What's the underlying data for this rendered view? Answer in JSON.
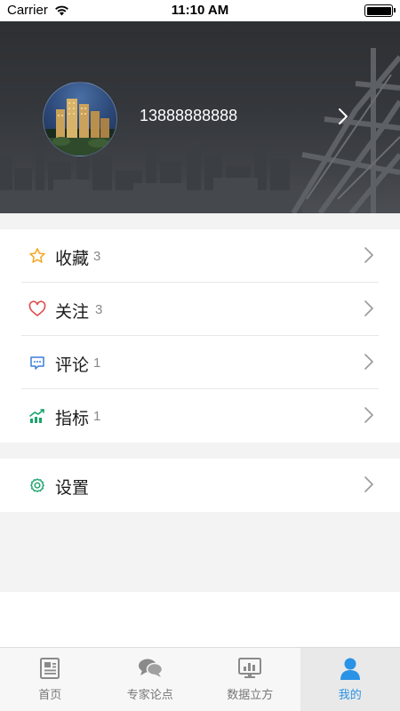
{
  "status_bar": {
    "carrier": "Carrier",
    "time": "11:10 AM"
  },
  "profile": {
    "phone": "13888888888"
  },
  "menu": {
    "items": [
      {
        "label": "收藏",
        "count": "3",
        "icon": "star-icon",
        "color": "#f5a623"
      },
      {
        "label": "关注",
        "count": "3",
        "icon": "heart-icon",
        "color": "#e04b4b"
      },
      {
        "label": "评论",
        "count": "1",
        "icon": "comment-icon",
        "color": "#3b7fd9"
      },
      {
        "label": "指标",
        "count": "1",
        "icon": "trend-chart-icon",
        "color": "#1aa36b"
      }
    ],
    "settings": {
      "label": "设置",
      "icon": "gear-icon",
      "color": "#1aa36b"
    }
  },
  "tabbar": {
    "tabs": [
      {
        "label": "首页",
        "icon": "newspaper-icon"
      },
      {
        "label": "专家论点",
        "icon": "chat-bubbles-icon"
      },
      {
        "label": "数据立方",
        "icon": "monitor-chart-icon"
      },
      {
        "label": "我的",
        "icon": "person-icon",
        "active": true
      }
    ],
    "active_color": "#2a93e6"
  }
}
